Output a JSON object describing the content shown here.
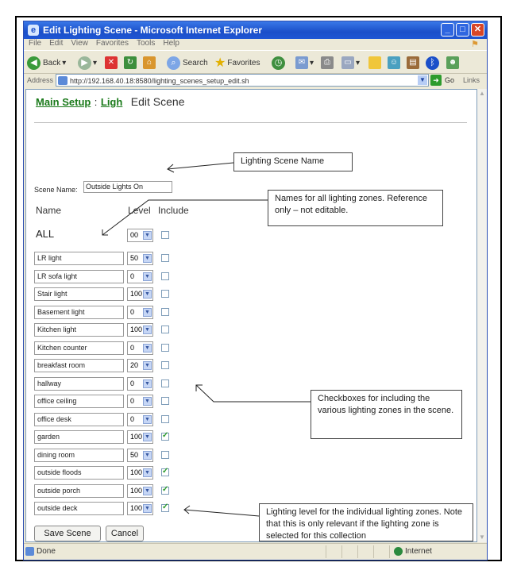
{
  "window": {
    "title": "Edit Lighting Scene - Microsoft Internet Explorer",
    "buttons": {
      "minimize": "_",
      "maximize": "□",
      "close": "✕"
    }
  },
  "menu": [
    "File",
    "Edit",
    "View",
    "Favorites",
    "Tools",
    "Help"
  ],
  "toolbar": {
    "back": "Back",
    "search": "Search",
    "favorites": "Favorites"
  },
  "address": {
    "label": "Address",
    "url": "http://192.168.40.18:8580/lighting_scenes_setup_edit.sh",
    "go": "Go",
    "links": "Links"
  },
  "breadcrumb": {
    "main": "Main Setup",
    "sep": ":",
    "ligh": "Ligh",
    "current": "Edit Scene"
  },
  "form": {
    "scene_name_label": "Scene Name:",
    "scene_name_value": "Outside Lights On",
    "header_name": "Name",
    "header_level": "Level",
    "header_include": "Include",
    "all_label": "ALL",
    "all_level": "00",
    "all_checked": false,
    "zones": [
      {
        "name": "LR light",
        "level": "50",
        "checked": false
      },
      {
        "name": "LR sofa light",
        "level": "0",
        "checked": false
      },
      {
        "name": "Stair light",
        "level": "100",
        "checked": false
      },
      {
        "name": "Basement light",
        "level": "0",
        "checked": false
      },
      {
        "name": "Kitchen light",
        "level": "100",
        "checked": false
      },
      {
        "name": "Kitchen counter",
        "level": "0",
        "checked": false
      },
      {
        "name": "breakfast room",
        "level": "20",
        "checked": false
      },
      {
        "name": "hallway",
        "level": "0",
        "checked": false
      },
      {
        "name": "office ceiling",
        "level": "0",
        "checked": false
      },
      {
        "name": "office desk",
        "level": "0",
        "checked": false
      },
      {
        "name": "garden",
        "level": "100",
        "checked": true
      },
      {
        "name": "dining room",
        "level": "50",
        "checked": false
      },
      {
        "name": "outside floods",
        "level": "100",
        "checked": true
      },
      {
        "name": "outside porch",
        "level": "100",
        "checked": true
      },
      {
        "name": "outside deck",
        "level": "100",
        "checked": true
      }
    ],
    "save_label": "Save Scene",
    "cancel_label": "Cancel"
  },
  "callouts": {
    "scene_name": "Lighting Scene Name",
    "zone_names": "Names for all lighting zones. Reference only – not editable.",
    "checkboxes": "Checkboxes for including the various lighting zones in the scene.",
    "level": "Lighting level for the individual lighting zones.  Note that this is only relevant if the lighting zone is selected for this collection"
  },
  "status": {
    "text": "Done",
    "zone": "Internet"
  }
}
